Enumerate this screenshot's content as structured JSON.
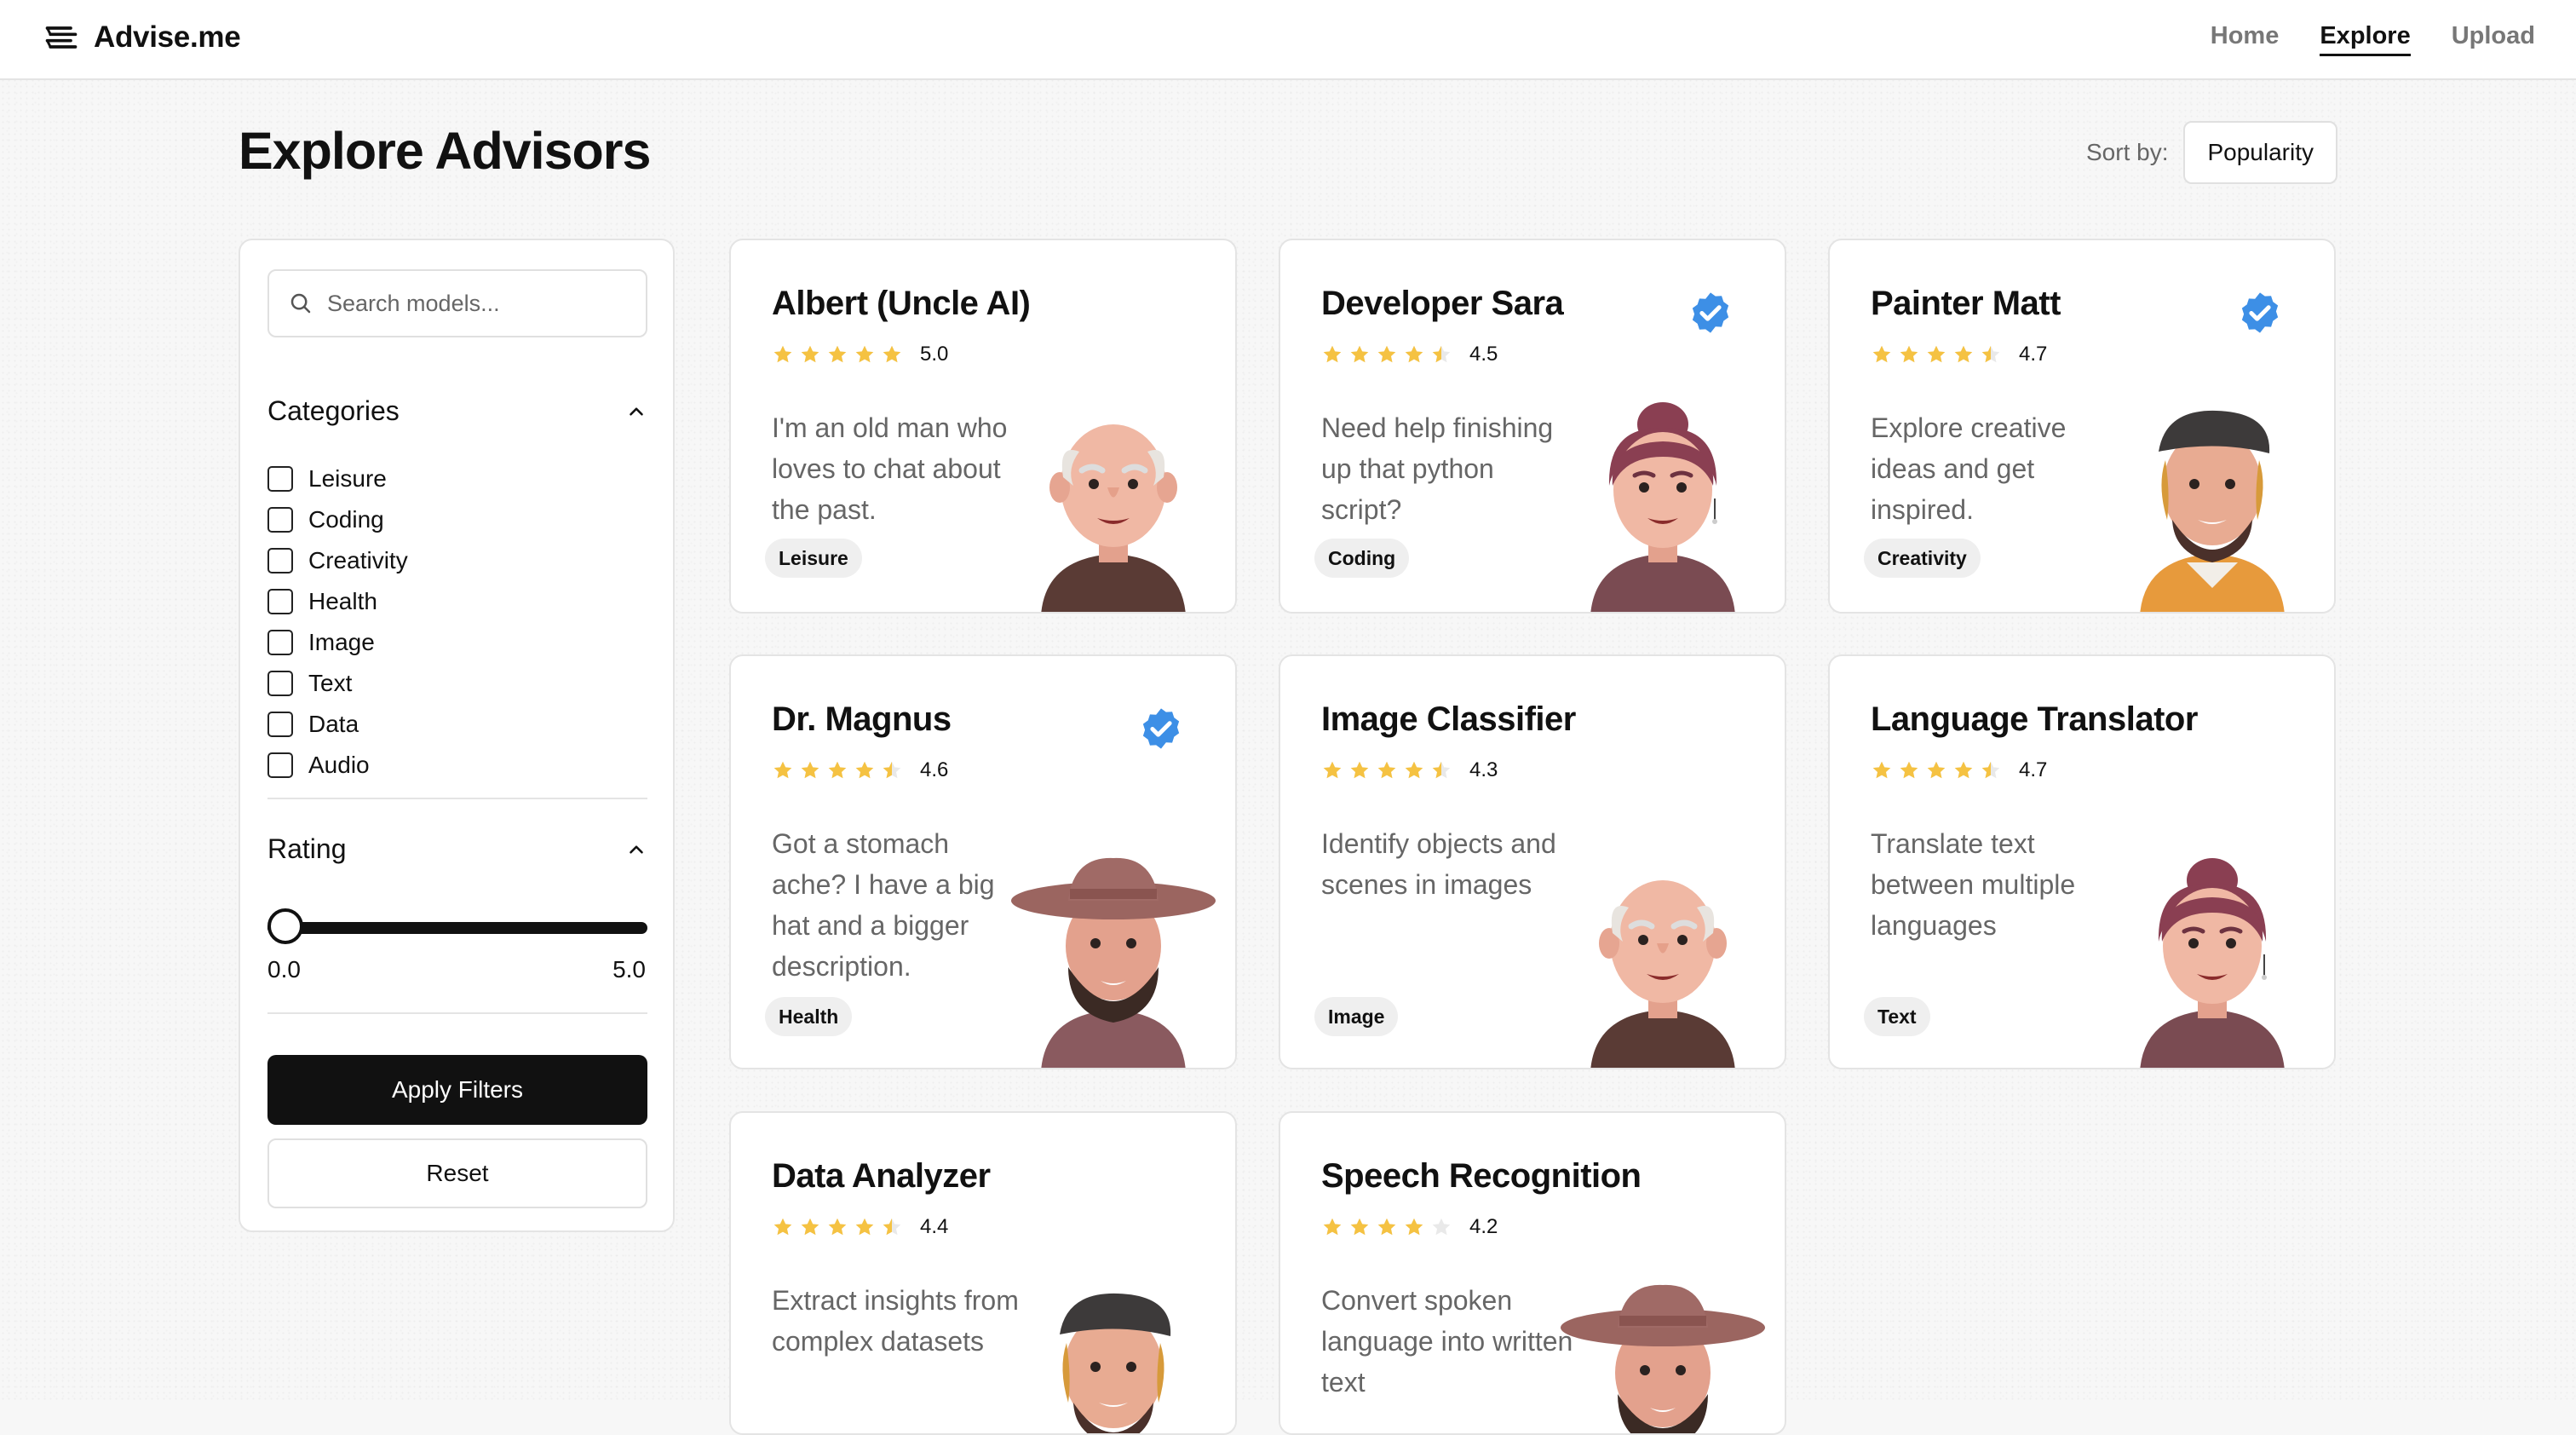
{
  "app": {
    "name": "Advise.me"
  },
  "nav": {
    "home": "Home",
    "explore": "Explore",
    "upload": "Upload"
  },
  "page": {
    "title": "Explore Advisors",
    "sort_label": "Sort by:",
    "sort_value": "Popularity"
  },
  "filters": {
    "search_placeholder": "Search models...",
    "categories_title": "Categories",
    "categories": [
      "Leisure",
      "Coding",
      "Creativity",
      "Health",
      "Image",
      "Text",
      "Data",
      "Audio"
    ],
    "rating_title": "Rating",
    "rating_min": "0.0",
    "rating_max": "5.0",
    "rating_value": 0.0,
    "apply_label": "Apply Filters",
    "reset_label": "Reset"
  },
  "colors": {
    "star": "#f5c242",
    "verified": "#3d8fe6",
    "primary": "#111111"
  },
  "advisors": [
    {
      "name": "Albert (Uncle AI)",
      "rating": 5.0,
      "score": "5.0",
      "verified": false,
      "description": "I'm an old man who loves to chat about the past.",
      "tag": "Leisure",
      "avatar": "old-man-avatar"
    },
    {
      "name": "Developer Sara",
      "rating": 4.5,
      "score": "4.5",
      "verified": true,
      "description": "Need help finishing up that python script?",
      "tag": "Coding",
      "avatar": "woman-bun-avatar"
    },
    {
      "name": "Painter Matt",
      "rating": 4.7,
      "score": "4.7",
      "verified": true,
      "description": "Explore creative ideas and get inspired.",
      "tag": "Creativity",
      "avatar": "beret-man-avatar"
    },
    {
      "name": "Dr. Magnus",
      "rating": 4.6,
      "score": "4.6",
      "verified": true,
      "description": "Got a stomach ache? I have a big hat and a bigger description.",
      "tag": "Health",
      "avatar": "hat-man-avatar"
    },
    {
      "name": "Image Classifier",
      "rating": 4.3,
      "score": "4.3",
      "verified": false,
      "description": "Identify objects and scenes in images",
      "tag": "Image",
      "avatar": "old-man-avatar"
    },
    {
      "name": "Language Translator",
      "rating": 4.7,
      "score": "4.7",
      "verified": false,
      "description": "Translate text between multiple languages",
      "tag": "Text",
      "avatar": "woman-bun-avatar"
    },
    {
      "name": "Data Analyzer",
      "rating": 4.4,
      "score": "4.4",
      "verified": false,
      "description": "Extract insights from complex datasets",
      "tag": "",
      "avatar": "beret-man-avatar"
    },
    {
      "name": "Speech Recognition",
      "rating": 4.2,
      "score": "4.2",
      "verified": false,
      "description": "Convert spoken language into written text",
      "tag": "",
      "avatar": "hat-man-avatar"
    }
  ]
}
